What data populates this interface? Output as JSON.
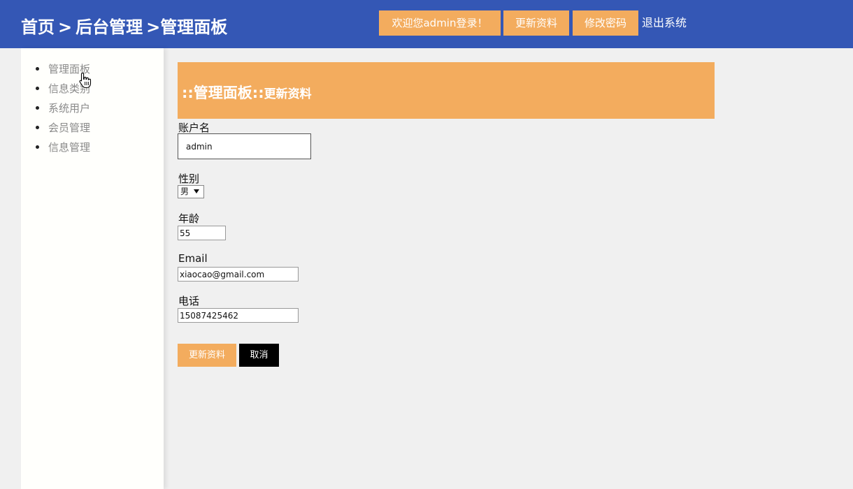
{
  "header": {
    "breadcrumb": {
      "home": "首页",
      "sep1": ">",
      "backend": "后台管理",
      "sep2": ">",
      "current": "管理面板"
    },
    "welcome_label": "欢迎您admin登录！",
    "update_profile_label": "更新资料",
    "change_password_label": "修改密码",
    "logout_label": "退出系统"
  },
  "sidebar": {
    "items": [
      {
        "label": "管理面板"
      },
      {
        "label": "信息类别"
      },
      {
        "label": "系统用户"
      },
      {
        "label": "会员管理"
      },
      {
        "label": "信息管理"
      }
    ]
  },
  "panel": {
    "title_main": "::管理面板::",
    "title_sub": "更新资料"
  },
  "form": {
    "account": {
      "label": "账户名",
      "value": "admin"
    },
    "gender": {
      "label": "性别",
      "value": "男"
    },
    "age": {
      "label": "年龄",
      "value": "55"
    },
    "email": {
      "label": "Email",
      "value": "xiaocao@gmail.com"
    },
    "phone": {
      "label": "电话",
      "value": "15087425462"
    },
    "submit_label": "更新资料",
    "cancel_label": "取消"
  },
  "colors": {
    "header_bg": "#3457b5",
    "accent": "#f3ac5e",
    "cancel_bg": "#000000",
    "page_bg": "#f0f0f0",
    "sidebar_bg": "#fffffc"
  },
  "icons": {
    "cursor": "hand-pointer-icon",
    "bullet": "bullet-icon",
    "select_arrow": "caret-down-icon"
  }
}
